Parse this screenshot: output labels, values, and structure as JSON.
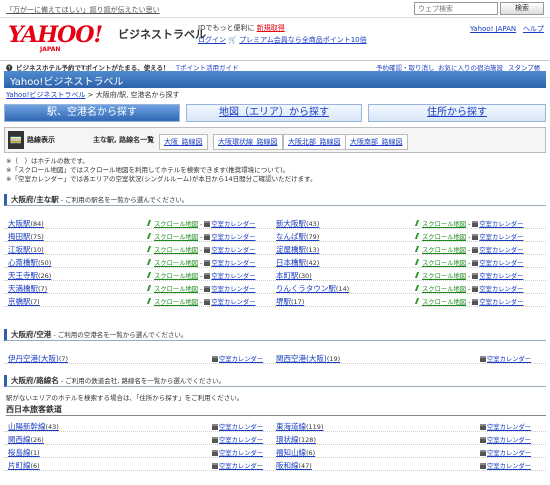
{
  "topbar": {
    "slogan": "「万が一に備えてほしい」謳り謳が伝えたい思い",
    "search_placeholder": "ウェブ検索",
    "search_button": "検索"
  },
  "header": {
    "logo": "YAHOO!",
    "logo_sub": "JAPAN",
    "service": "ビジネストラベル",
    "promo_line1_prefix": "IDでもっと便利に",
    "promo_line1_link": "新規取得",
    "promo_line2_link": "ログイン",
    "promo_line2_text": "プレミアム会員なら全商品ポイント10倍",
    "link_home": "Yahoo! JAPAN",
    "link_help": "ヘルプ"
  },
  "pointrow": {
    "left": "ビジネスホテル予約でTポイントがたまる、使える！",
    "left_link": "Tポイント活用ガイド",
    "right1": "予約確認・取り消し",
    "right2": "お気に入りの宿泊施設",
    "right3": "スタンプ帳"
  },
  "title": "Yahoo!ビジネストラベル",
  "breadcrumb": {
    "home": "Yahoo!ビジネストラベル",
    "current": " > 大阪府/駅, 空港名から探す"
  },
  "tabs": [
    {
      "label": "駅、空港名から探す"
    },
    {
      "label": "地図（エリア）から探す"
    },
    {
      "label": "住所から探す"
    }
  ],
  "routebar": {
    "title": "路線表示",
    "selected": "主な駅, 路線名一覧",
    "links": [
      "大阪_路線図",
      "大阪環状線_路線図",
      "大阪北部_路線図",
      "大阪南部_路線図"
    ]
  },
  "notes": {
    "line1": "※（　）はホテルの数です。",
    "line2": "※「スクロール地図」ではスクロール地図を利用してホテルを検索できます(推奨環境について)。",
    "line3": "※「空室カレンダー」では各エリアの空室状況(シングルルーム)が本日から14日間分ご確認いただけます。"
  },
  "section_station": {
    "title": "大阪府/主な駅",
    "desc": " - ご利用の駅名を一覧から選んでください。"
  },
  "station_rows": [
    [
      {
        "name": "大阪駅",
        "count": "(84)"
      },
      {
        "name": "新大阪駅",
        "count": "(43)"
      }
    ],
    [
      {
        "name": "梅田駅",
        "count": "(75)"
      },
      {
        "name": "なんば駅",
        "count": "(79)"
      }
    ],
    [
      {
        "name": "江坂駅",
        "count": "(10)"
      },
      {
        "name": "淀屋橋駅",
        "count": "(13)"
      }
    ],
    [
      {
        "name": "心斎橋駅",
        "count": "(50)"
      },
      {
        "name": "日本橋駅",
        "count": "(42)"
      }
    ],
    [
      {
        "name": "天王寺駅",
        "count": "(26)"
      },
      {
        "name": "本町駅",
        "count": "(30)"
      }
    ],
    [
      {
        "name": "天満橋駅",
        "count": "(7)"
      },
      {
        "name": "りんくうタウン駅",
        "count": "(14)"
      }
    ],
    [
      {
        "name": "京橋駅",
        "count": "(7)"
      },
      {
        "name": "堺駅",
        "count": "(17)"
      }
    ]
  ],
  "labels": {
    "scroll": "スクロール地図",
    "calendar": "空室カレンダー"
  },
  "section_airport": {
    "title": "大阪府/空港",
    "desc": " - ご利用の空港名を一覧から選んでください。"
  },
  "airport_row": [
    {
      "name": "伊丹空港(大阪)",
      "count": "(7)"
    },
    {
      "name": "関西空港(大阪)",
      "count": "(19)"
    }
  ],
  "section_route": {
    "title": "大阪府/路線名",
    "desc": " - ご利用の鉄道会社, 路線名を一覧から選んでください。"
  },
  "region_note": "駅がないエリアのホテルを検索する場合は、「住所から探す」をご利用ください。",
  "company": "西日本旅客鉄道",
  "route_rows": [
    [
      {
        "name": "山陽新幹線",
        "count": "(43)"
      },
      {
        "name": "東海道線",
        "count": "(119)"
      }
    ],
    [
      {
        "name": "関西線",
        "count": "(26)"
      },
      {
        "name": "環状線",
        "count": "(128)"
      }
    ],
    [
      {
        "name": "桜島線",
        "count": "(1)"
      },
      {
        "name": "福知山線",
        "count": "(6)"
      }
    ],
    [
      {
        "name": "片町線",
        "count": "(6)"
      },
      {
        "name": "阪和線",
        "count": "(47)"
      }
    ]
  ]
}
